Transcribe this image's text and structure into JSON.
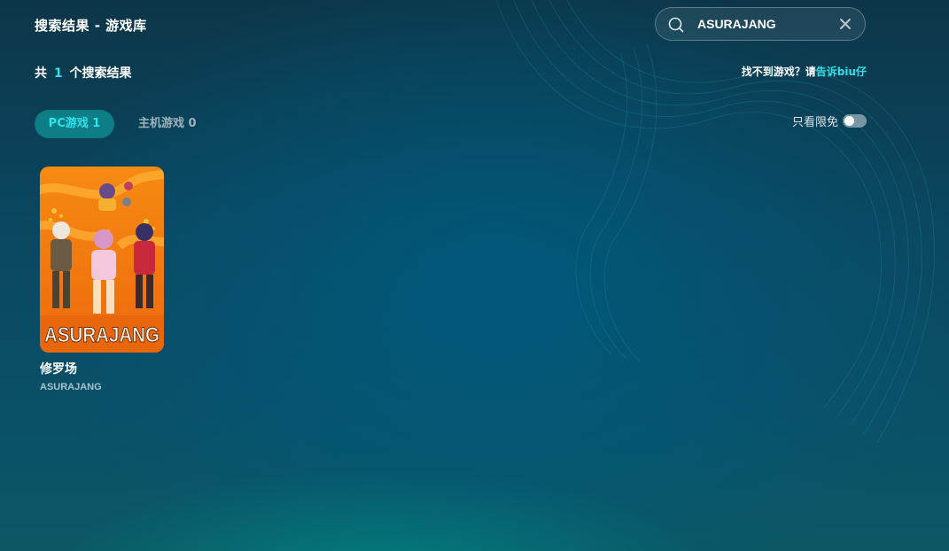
{
  "page": {
    "title": "搜索结果 - 游戏库"
  },
  "search": {
    "value": "ASURAJANG"
  },
  "results": {
    "prefix": "共",
    "count": "1",
    "suffix": "个搜索结果"
  },
  "feedback": {
    "text": "找不到游戏？请",
    "link_text": "告诉biu仔"
  },
  "tabs": [
    {
      "label": "PC游戏 1",
      "active": true
    },
    {
      "label": "主机游戏 0",
      "active": false
    }
  ],
  "filter": {
    "free_only_label": "只看限免",
    "free_only_on": false
  },
  "games": [
    {
      "title": "修罗场",
      "subtitle": "ASURAJANG",
      "cover_logo_text": "ASURAJANG"
    }
  ],
  "colors": {
    "accent": "#2ee0e8",
    "tab_active_bg": "#0d7d86",
    "cover_orange": "#f07a10"
  }
}
